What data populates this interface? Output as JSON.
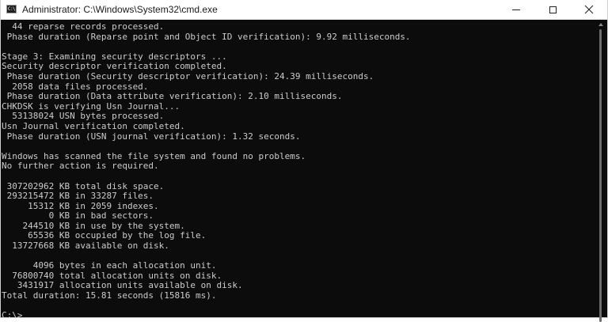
{
  "window": {
    "title": "Administrator: C:\\Windows\\System32\\cmd.exe",
    "app_icon_text": "C:\\"
  },
  "console": {
    "lines": [
      "  44 reparse records processed.",
      " Phase duration (Reparse point and Object ID verification): 9.92 milliseconds.",
      "",
      "Stage 3: Examining security descriptors ...",
      "Security descriptor verification completed.",
      " Phase duration (Security descriptor verification): 24.39 milliseconds.",
      "  2058 data files processed.",
      " Phase duration (Data attribute verification): 2.10 milliseconds.",
      "CHKDSK is verifying Usn Journal...",
      "  53138024 USN bytes processed.",
      "Usn Journal verification completed.",
      " Phase duration (USN journal verification): 1.32 seconds.",
      "",
      "Windows has scanned the file system and found no problems.",
      "No further action is required.",
      "",
      " 307202962 KB total disk space.",
      " 293215472 KB in 33287 files.",
      "     15312 KB in 2059 indexes.",
      "         0 KB in bad sectors.",
      "    244510 KB in use by the system.",
      "     65536 KB occupied by the log file.",
      "  13727668 KB available on disk.",
      "",
      "      4096 bytes in each allocation unit.",
      "  76800740 total allocation units on disk.",
      "   3431917 allocation units available on disk.",
      "Total duration: 15.81 seconds (15816 ms).",
      "",
      "C:\\>"
    ]
  }
}
